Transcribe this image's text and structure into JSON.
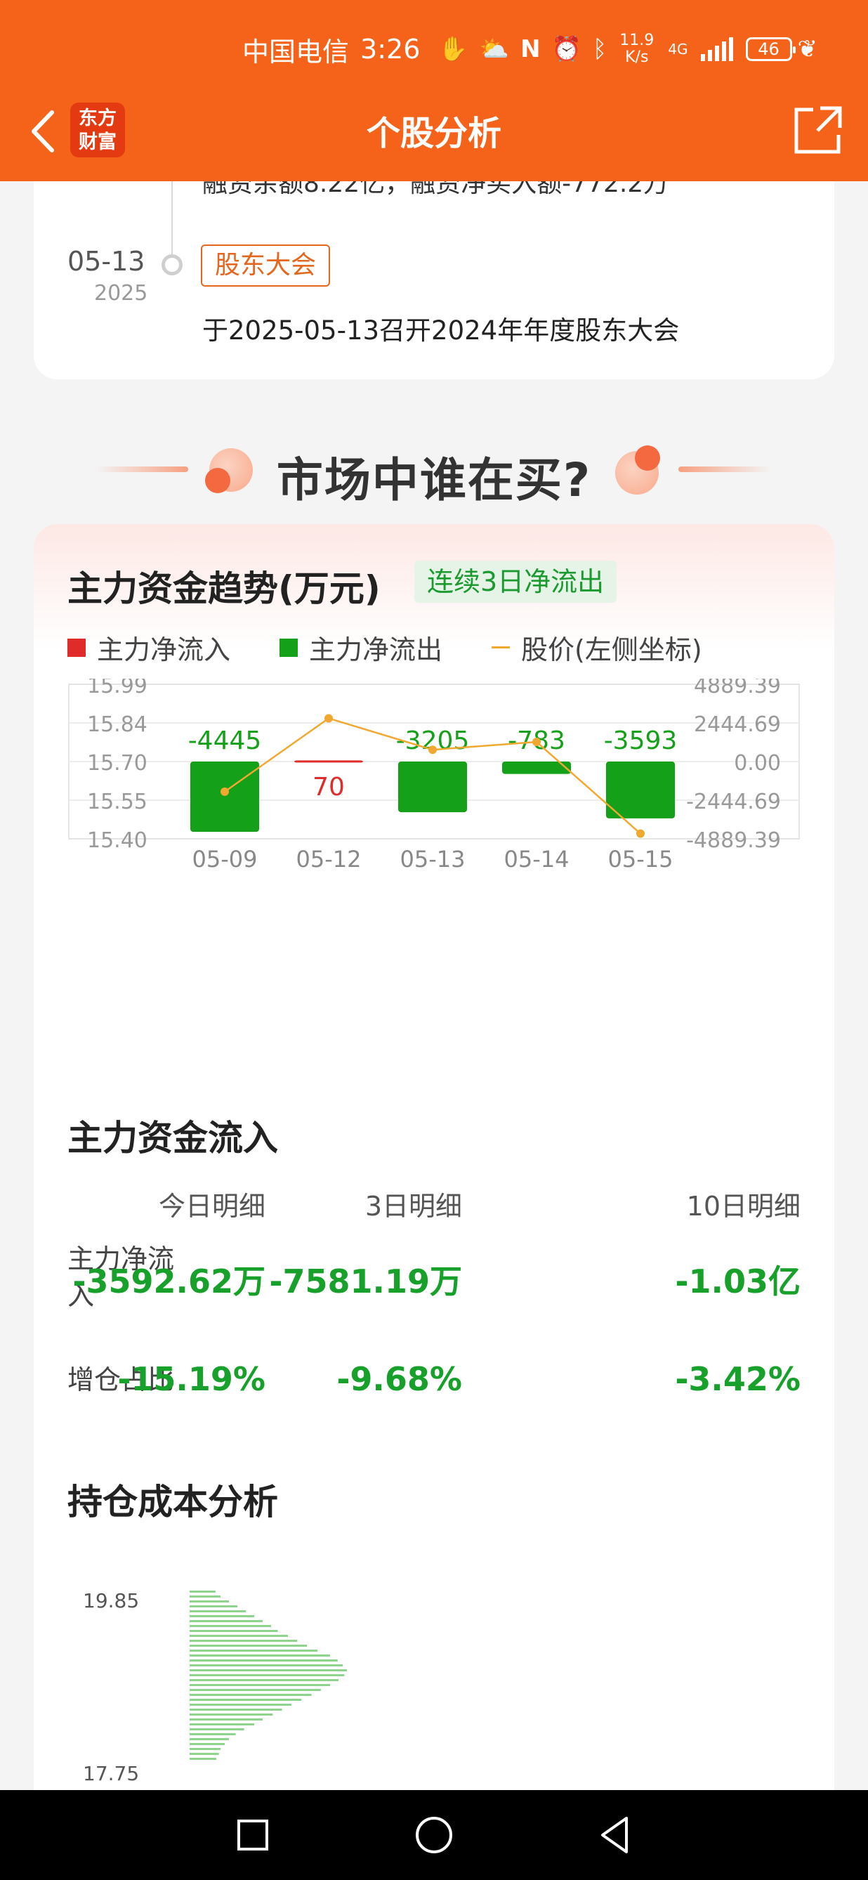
{
  "status_bar": {
    "carrier": "中国电信",
    "time": "3:26",
    "speed_value": "11.9",
    "speed_unit": "K/s",
    "network": "4G",
    "battery": "46"
  },
  "nav": {
    "logo_line1": "东方",
    "logo_line2": "财富",
    "title": "个股分析"
  },
  "timeline": {
    "cut_text": "融资余额8.22亿，融资净买入额-772.2万",
    "events": [
      {
        "date": "05-13",
        "year": "2025",
        "tag": "股东大会",
        "text": "于2025-05-13召开2024年年度股东大会"
      }
    ]
  },
  "banner": {
    "title": "市场中谁在买?"
  },
  "trend": {
    "title": "主力资金趋势(万元)",
    "badge": "连续3日净流出",
    "legend": [
      {
        "label": "主力净流入",
        "color": "#e02b2b",
        "shape": "square"
      },
      {
        "label": "主力净流出",
        "color": "#14a019",
        "shape": "square"
      },
      {
        "label": "股价(左侧坐标)",
        "color": "#f0a830",
        "shape": "line"
      }
    ]
  },
  "chart_data": {
    "type": "bar",
    "categories": [
      "05-09",
      "05-12",
      "05-13",
      "05-14",
      "05-15"
    ],
    "series": [
      {
        "name": "主力净流入",
        "values": [
          -4445,
          70,
          -3205,
          -783,
          -3593
        ]
      }
    ],
    "value_labels": [
      "-4445",
      "70",
      "-3205",
      "-783",
      "-3593"
    ],
    "bar_values": [
      -4445,
      70,
      -3205,
      -783,
      -3593
    ],
    "price_values": [
      15.58,
      15.86,
      15.74,
      15.77,
      15.42
    ],
    "left_ticks": [
      "15.99",
      "15.84",
      "15.70",
      "15.55",
      "15.40"
    ],
    "left_range": [
      15.4,
      15.99
    ],
    "right_ticks": [
      "4889.39",
      "2444.69",
      "0.00",
      "-2444.69",
      "-4889.39"
    ],
    "right_range": [
      -4889.39,
      4889.39
    ],
    "up_color": "#e02b2b",
    "down_color": "#14a019",
    "price_color": "#f0a830"
  },
  "inflow": {
    "title": "主力资金流入",
    "columns": [
      "今日明细",
      "3日明细",
      "10日明细"
    ],
    "rows": [
      {
        "label": "主力净流入",
        "values": [
          "-3592.62万",
          "-7581.19万",
          "-1.03亿"
        ]
      },
      {
        "label": "增仓占比",
        "values": [
          "-15.19%",
          "-9.68%",
          "-3.42%"
        ]
      }
    ]
  },
  "cost": {
    "title": "持仓成本分析",
    "axis_top": "19.85",
    "axis_bottom": "17.75",
    "bar_color": "#8fd38f"
  }
}
